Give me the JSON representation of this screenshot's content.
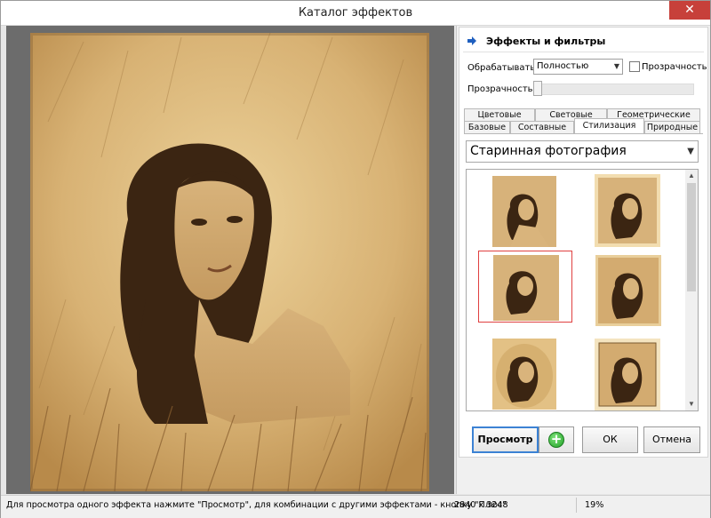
{
  "window": {
    "title": "Каталог эффектов",
    "close_glyph": "✕"
  },
  "panel": {
    "header_icon": "arrow-right-icon",
    "header": "Эффекты и фильтры",
    "process_label": "Обрабатывать",
    "process_value": "Полностью",
    "transparency_checkbox_label": "Прозрачность",
    "transparency_checked": false,
    "opacity_label": "Прозрачность",
    "opacity_value": 0
  },
  "tabs": {
    "row1": [
      "Цветовые",
      "Световые",
      "Геометрические"
    ],
    "row2": [
      "Базовые",
      "Составные",
      "Стилизация",
      "Природные"
    ],
    "active": "Стилизация"
  },
  "effect_category": "Старинная фотография",
  "thumbnails": {
    "count_visible": 6,
    "selected_index": 2
  },
  "buttons": {
    "preview": "Просмотр",
    "plus_icon": "plus-circle-icon",
    "plus_glyph": "+",
    "ok": "ОК",
    "cancel": "Отмена"
  },
  "status": {
    "hint": "Для просмотра одного эффекта нажмите \"Просмотр\", для комбинации с другими эффектами - кнопку \"Плюс\"",
    "image_size": "2840 x 3248",
    "zoom": "19%"
  },
  "colors": {
    "sepia_light": "#e8c98c",
    "sepia_mid": "#c79d5c",
    "sepia_dark": "#3b2512",
    "selection_red": "#e04040",
    "preview_border": "#3c82d4",
    "close_red": "#c7403a"
  }
}
